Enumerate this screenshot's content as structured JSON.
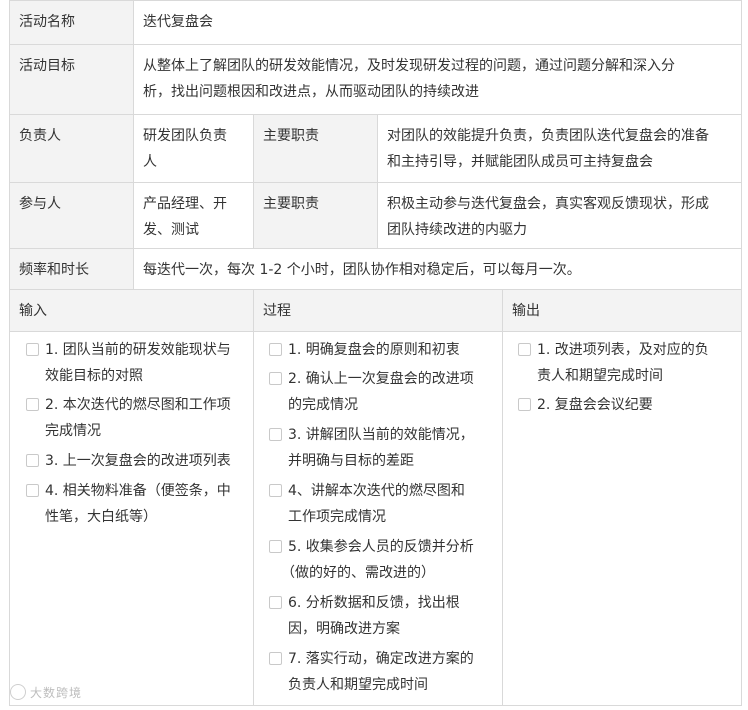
{
  "rows": {
    "name": {
      "label": "活动名称",
      "value": "迭代复盘会"
    },
    "goal": {
      "label": "活动目标",
      "value_lines": [
        "从整体上了解团队的研发效能情况，及时发现研发过程的问题，通过问题分解和深入分",
        "析，找出问题根因和改进点，从而驱动团队的持续改进"
      ]
    },
    "owner": {
      "label": "负责人",
      "who_lines": [
        "研发团队负责",
        "人"
      ],
      "duty_label": "主要职责",
      "duty_lines": [
        "对团队的效能提升负责，负责团队迭代复盘会的准备",
        "和主持引导，并赋能团队成员可主持复盘会"
      ]
    },
    "participants": {
      "label": "参与人",
      "who_lines": [
        "产品经理、开",
        "发、测试"
      ],
      "duty_label": "主要职责",
      "duty_lines": [
        "积极主动参与迭代复盘会，真实客观反馈现状，形成",
        "团队持续改进的内驱力"
      ]
    },
    "frequency": {
      "label": "频率和时长",
      "value": "每迭代一次，每次 1-2 个小时，团队协作相对稳定后，可以每月一次。"
    }
  },
  "columns": {
    "input": {
      "header": "输入",
      "items": [
        [
          "1. 团队当前的研发效能现状与",
          "效能目标的对照"
        ],
        [
          "2. 本次迭代的燃尽图和工作项",
          "完成情况"
        ],
        [
          "3. 上一次复盘会的改进项列表"
        ],
        [
          "4. 相关物料准备（便签条，中",
          "性笔，大白纸等）"
        ]
      ]
    },
    "process": {
      "header": "过程",
      "items": [
        [
          "1. 明确复盘会的原则和初衷"
        ],
        [
          "2. 确认上一次复盘会的改进项",
          "的完成情况"
        ],
        [
          "3. 讲解团队当前的效能情况，",
          "并明确与目标的差距"
        ],
        [
          "4、讲解本次迭代的燃尽图和",
          "工作项完成情况"
        ],
        [
          "5. 收集参会人员的反馈并分析",
          "（做的好的、需改进的）"
        ],
        [
          "6. 分析数据和反馈，找出根",
          "因，明确改进方案"
        ],
        [
          "7. 落实行动，确定改进方案的",
          "负责人和期望完成时间"
        ]
      ]
    },
    "output": {
      "header": "输出",
      "items": [
        [
          "1. 改进项列表，及对应的负",
          "责人和期望完成时间"
        ],
        [
          "2. 复盘会会议纪要"
        ]
      ]
    }
  },
  "watermark": "大数跨境"
}
